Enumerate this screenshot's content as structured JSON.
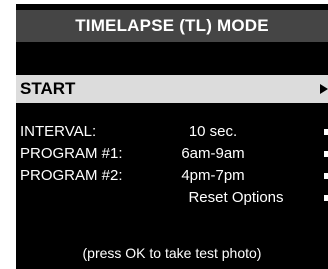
{
  "header": {
    "title": "TIMELAPSE (TL) MODE"
  },
  "menu": {
    "start_label": "START",
    "start_arrow_icon": "arrow-right-icon",
    "rows": [
      {
        "label": "INTERVAL:",
        "value": "10 sec."
      },
      {
        "label": "PROGRAM #1:",
        "value": "6am-9am"
      },
      {
        "label": "PROGRAM #2:",
        "value": "4pm-7pm"
      },
      {
        "label": "",
        "value": "Reset Options"
      }
    ]
  },
  "footer": {
    "hint": "(press OK to take test photo)"
  },
  "colors": {
    "background": "#000000",
    "title_bar": "#454545",
    "selected_row": "#dcdcdc",
    "text": "#ffffff"
  }
}
